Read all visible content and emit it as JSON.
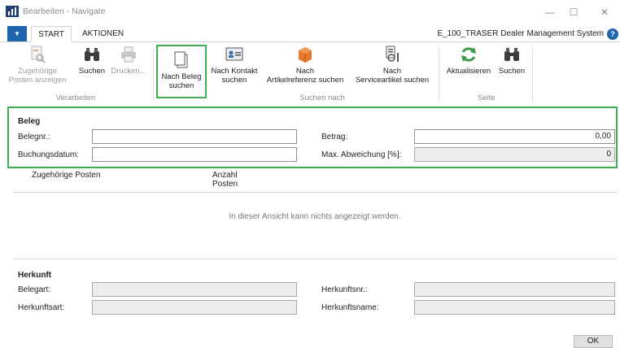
{
  "window": {
    "title": "Bearbeiten - Navigate",
    "min_glyph": "—",
    "max_glyph": "☐",
    "close_glyph": "✕"
  },
  "tabs": {
    "menu_glyph": "▼",
    "start": "START",
    "aktionen": "AKTIONEN"
  },
  "company": "E_100_TRASER Dealer Management System",
  "help_glyph": "?",
  "ribbon": {
    "buttons": {
      "zugehoerige_l1": "Zugehörige",
      "zugehoerige_l2": "Posten anzeigen",
      "suchen": "Suchen",
      "drucken": "Drucken...",
      "nach_beleg_l1": "Nach Beleg",
      "nach_beleg_l2": "suchen",
      "nach_kontakt_l1": "Nach Kontakt",
      "nach_kontakt_l2": "suchen",
      "nach_artikel_l1": "Nach",
      "nach_artikel_l2": "Artikelreferenz suchen",
      "nach_service_l1": "Nach",
      "nach_service_l2": "Serviceartikel suchen",
      "aktualisieren": "Aktualisieren",
      "suchen2": "Suchen"
    },
    "groups": {
      "verarbeiten": "Verarbeiten",
      "suchen_nach": "Suchen nach",
      "seite": "Seite"
    },
    "icons": [
      "posten-icon",
      "binoculars-icon",
      "printer-icon",
      "documents-icon",
      "contact-card-icon",
      "item-box-icon",
      "service-item-icon",
      "refresh-icon",
      "binoculars-icon"
    ]
  },
  "beleg": {
    "title": "Beleg",
    "belegnr_label": "Belegnr.:",
    "belegnr_value": "",
    "buchungsdatum_label": "Buchungsdatum:",
    "buchungsdatum_value": "",
    "betrag_label": "Betrag:",
    "betrag_value": "0,00",
    "max_abw_label": "Max. Abweichung [%]:",
    "max_abw_value": "0"
  },
  "list": {
    "col1": "Zugehörige Posten",
    "col2_l1": "Anzahl",
    "col2_l2": "Posten",
    "empty": "In dieser Ansicht kann nichts angezeigt werden."
  },
  "herkunft": {
    "title": "Herkunft",
    "belegart_label": "Belegart:",
    "belegart_value": "",
    "herkunftsart_label": "Herkunftsart:",
    "herkunftsart_value": "",
    "herkunftsnr_label": "Herkunftsnr.:",
    "herkunftsnr_value": "",
    "herkunftsname_label": "Herkunftsname:",
    "herkunftsname_value": ""
  },
  "ok": "OK",
  "colors": {
    "accent_blue": "#1f64ae",
    "highlight_green": "#3dae52",
    "icon_orange": "#e8782c",
    "icon_green": "#3a9b4a"
  }
}
